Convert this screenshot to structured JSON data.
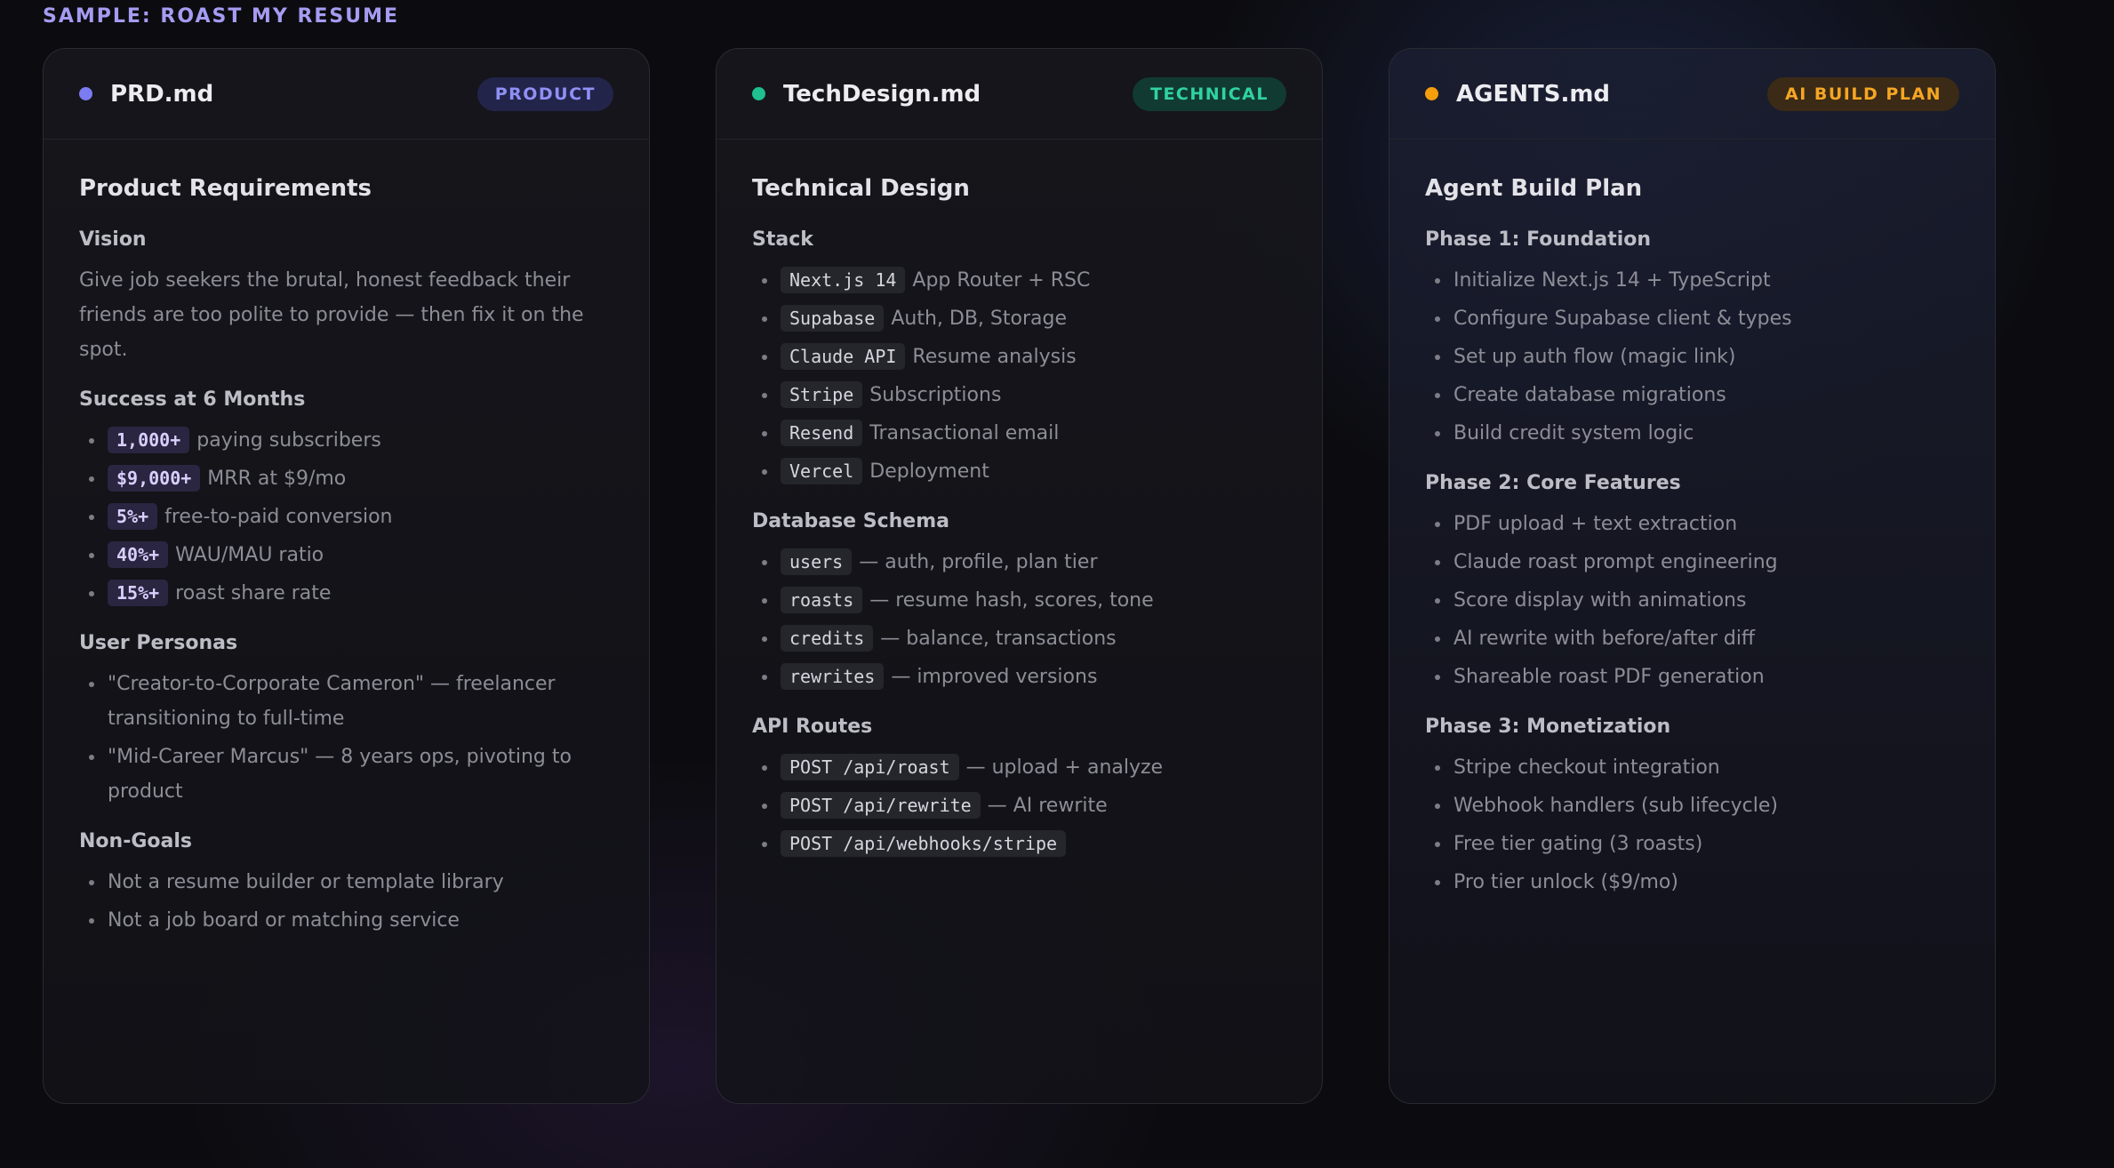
{
  "sample_label": "SAMPLE: ROAST MY RESUME",
  "colors": {
    "product": "#7b7cf2",
    "technical": "#1fbf8f",
    "ai_build_plan": "#f59e0b"
  },
  "cards": [
    {
      "file": "PRD.md",
      "badge": "PRODUCT",
      "title": "Product Requirements",
      "vision_heading": "Vision",
      "vision_text": "Give job seekers the brutal, honest feedback their friends are too polite to provide — then fix it on the spot.",
      "success_heading": "Success at 6 Months",
      "success_items": [
        {
          "metric": "1,000+",
          "text": "paying subscribers"
        },
        {
          "metric": "$9,000+",
          "text": "MRR at $9/mo"
        },
        {
          "metric": "5%+",
          "text": "free-to-paid conversion"
        },
        {
          "metric": "40%+",
          "text": "WAU/MAU ratio"
        },
        {
          "metric": "15%+",
          "text": "roast share rate"
        }
      ],
      "personas_heading": "User Personas",
      "personas": [
        "\"Creator-to-Corporate Cameron\" — freelancer transitioning to full-time",
        "\"Mid-Career Marcus\" — 8 years ops, pivoting to product"
      ],
      "nongoals_heading": "Non-Goals",
      "nongoals": [
        "Not a resume builder or template library",
        "Not a job board or matching service"
      ]
    },
    {
      "file": "TechDesign.md",
      "badge": "TECHNICAL",
      "title": "Technical Design",
      "stack_heading": "Stack",
      "stack": [
        {
          "code": "Next.js 14",
          "text": "App Router + RSC"
        },
        {
          "code": "Supabase",
          "text": "Auth, DB, Storage"
        },
        {
          "code": "Claude API",
          "text": "Resume analysis"
        },
        {
          "code": "Stripe",
          "text": "Subscriptions"
        },
        {
          "code": "Resend",
          "text": "Transactional email"
        },
        {
          "code": "Vercel",
          "text": "Deployment"
        }
      ],
      "schema_heading": "Database Schema",
      "schema": [
        {
          "code": "users",
          "text": "— auth, profile, plan tier"
        },
        {
          "code": "roasts",
          "text": "— resume hash, scores, tone"
        },
        {
          "code": "credits",
          "text": "— balance, transactions"
        },
        {
          "code": "rewrites",
          "text": "— improved versions"
        }
      ],
      "routes_heading": "API Routes",
      "routes": [
        {
          "code": "POST /api/roast",
          "text": "— upload + analyze"
        },
        {
          "code": "POST /api/rewrite",
          "text": "— AI rewrite"
        },
        {
          "code": "POST /api/webhooks/stripe",
          "text": ""
        }
      ]
    },
    {
      "file": "AGENTS.md",
      "badge": "AI BUILD PLAN",
      "title": "Agent Build Plan",
      "phase1_heading": "Phase 1: Foundation",
      "phase1": [
        "Initialize Next.js 14 + TypeScript",
        "Configure Supabase client & types",
        "Set up auth flow (magic link)",
        "Create database migrations",
        "Build credit system logic"
      ],
      "phase2_heading": "Phase 2: Core Features",
      "phase2": [
        "PDF upload + text extraction",
        "Claude roast prompt engineering",
        "Score display with animations",
        "AI rewrite with before/after diff",
        "Shareable roast PDF generation"
      ],
      "phase3_heading": "Phase 3: Monetization",
      "phase3": [
        "Stripe checkout integration",
        "Webhook handlers (sub lifecycle)",
        "Free tier gating (3 roasts)",
        "Pro tier unlock ($9/mo)"
      ]
    }
  ]
}
